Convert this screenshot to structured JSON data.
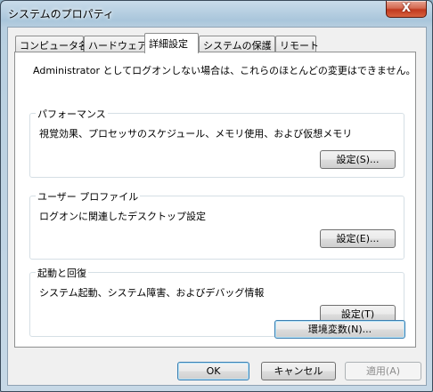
{
  "window": {
    "title": "システムのプロパティ",
    "close_label": "X"
  },
  "tabs": [
    {
      "label": "コンピュータ名"
    },
    {
      "label": "ハードウェア"
    },
    {
      "label": "詳細設定"
    },
    {
      "label": "システムの保護"
    },
    {
      "label": "リモート"
    }
  ],
  "notice": "Administrator としてログオンしない場合は、これらのほとんどの変更はできません。",
  "groups": {
    "performance": {
      "title": "パフォーマンス",
      "description": "視覚効果、プロセッサのスケジュール、メモリ使用、および仮想メモリ",
      "button": "設定(S)..."
    },
    "user_profile": {
      "title": "ユーザー プロファイル",
      "description": "ログオンに関連したデスクトップ設定",
      "button": "設定(E)..."
    },
    "startup_recovery": {
      "title": "起動と回復",
      "description": "システム起動、システム障害、およびデバッグ情報",
      "button": "設定(T)"
    }
  },
  "env_button": "環境変数(N)...",
  "footer": {
    "ok": "OK",
    "cancel": "キャンセル",
    "apply": "適用(A)"
  }
}
